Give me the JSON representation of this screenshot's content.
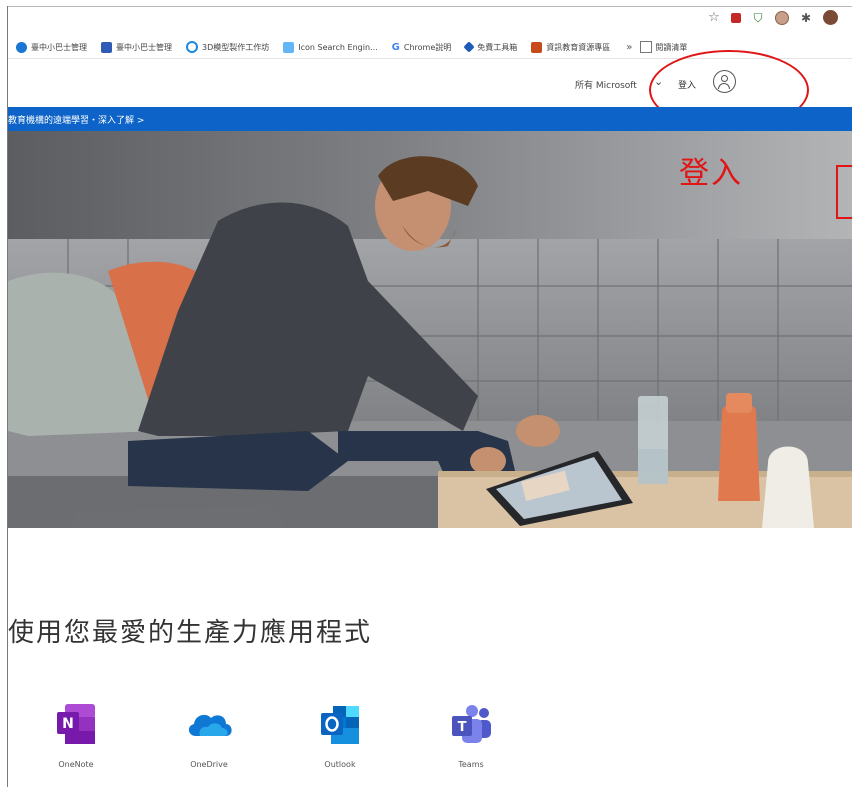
{
  "browser": {
    "extension_icons": [
      "star-icon",
      "red-square-icon",
      "shield-icon",
      "round-extension-icon",
      "puzzle-icon",
      "profile-avatar-icon"
    ],
    "bookmarks": [
      {
        "label": "臺中小巴士管理",
        "icon": "circle-icon"
      },
      {
        "label": "臺中小巴士管理",
        "icon": "facebook-icon"
      },
      {
        "label": "3D模型製作工作坊",
        "icon": "ring-icon"
      },
      {
        "label": "Icon Search Engin...",
        "icon": "blue-square-icon"
      },
      {
        "label": "Chrome說明",
        "icon": "google-icon"
      },
      {
        "label": "免費工具箱",
        "icon": "flag-icon"
      },
      {
        "label": "資訊教育資源專區",
        "icon": "red-square-icon"
      }
    ],
    "bookmarks_more": "»",
    "bookmarks_end_label": "閱讀清單"
  },
  "header": {
    "all_microsoft": "所有 Microsoft",
    "signin_label": "登入"
  },
  "banner": {
    "text": "教育機構的遠端學習・深入了解 >"
  },
  "annotation": {
    "label": "登入",
    "color": "#e01515"
  },
  "main": {
    "apps_title": "使用您最愛的生產力應用程式",
    "apps": [
      {
        "label": "OneNote",
        "icon": "onenote-icon"
      },
      {
        "label": "OneDrive",
        "icon": "onedrive-icon"
      },
      {
        "label": "Outlook",
        "icon": "outlook-icon"
      },
      {
        "label": "Teams",
        "icon": "teams-icon"
      }
    ]
  },
  "colors": {
    "banner_blue": "#0d63c7",
    "onenote_purple": "#7719aa",
    "onedrive_blue": "#0f78d4",
    "outlook_blue": "#0a64c2",
    "teams_purple": "#5059c9"
  }
}
